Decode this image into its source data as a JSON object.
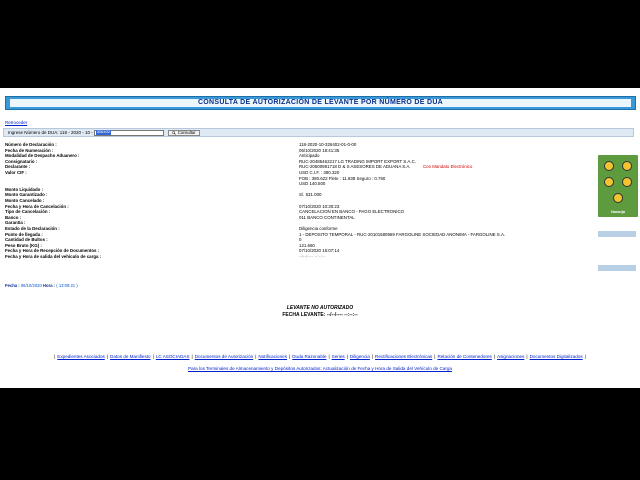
{
  "header": {
    "title": "CONSULTA DE AUTORIZACIÓN DE LEVANTE POR NÚMERO DE DUA"
  },
  "nav": {
    "back_label": "Retroceder"
  },
  "search": {
    "label": "Ingrese Número de DUA: 118 - 2020 - 10 -",
    "value": "326402",
    "button_label": "Consultar",
    "button_icon": "search-icon"
  },
  "details": [
    {
      "label": "Número de Declaración :",
      "value": "118-2020-10-326402-01-0-00"
    },
    {
      "label": "Fecha de Numeración :",
      "value": "06/10/2020 18:41:35"
    },
    {
      "label": "Modalidad de Despacho Aduanero :",
      "value": "Anticipado"
    },
    {
      "label": "Consignatario :",
      "value": "RUC-20485462217 LG TRADING IMPORT EXPORT S.A.C."
    },
    {
      "label": "Declarante :",
      "value": "RUC-20500981718 D & S ASESORES DE ADUANA S.A.",
      "value_extra": "Con Mandato Electrónico"
    },
    {
      "label": "Valor CIF :",
      "value": "USD C.I.F. : 380.320"
    },
    {
      "label": "",
      "value": "FOB : 380.622  Flete : 11.838  Seguro : 0.760"
    },
    {
      "label": "",
      "value": "USD 140.500"
    },
    {
      "label": "Monto Liquidado :",
      "value": ""
    },
    {
      "label": "Monto Garantizado :",
      "value": "S/. 531.000"
    },
    {
      "label": "Monto Cancelado :",
      "value": ""
    },
    {
      "label": "Fecha y Hora de Cancelación :",
      "value": "07/10/2020 10:30:23"
    },
    {
      "label": "Tipo de Cancelación :",
      "value": "CANCELACION EN BANCO - PAGO ELECTRONICO"
    },
    {
      "label": "Banco :",
      "value": "011 BANCO CONTINENTAL"
    },
    {
      "label": "Garantía :",
      "value": ""
    },
    {
      "label": "Estado de la Declaración :",
      "value": "Diligencia conforme"
    },
    {
      "label": "Punto de llegada :",
      "value": "1 - DEPOSITO TEMPORAL - RUC-20101580969 FARGOLINE SOCIEDAD ANONIMA - FARGOLINE S.A."
    },
    {
      "label": "Cantidad de Bultos :",
      "value": "0"
    },
    {
      "label": "Peso Bruto (KG) :",
      "value": "121.660"
    },
    {
      "label": "Fecha y Hora de Recepción de Documentos :",
      "value": "07/10/2020 16:07:14"
    },
    {
      "label": "Fecha y Hora de salida del vehículo de carga :",
      "value": "--/--/---- --:--:--"
    }
  ],
  "semaforo": {
    "label": "Naranja",
    "color": "#5e9a3e"
  },
  "timestamp": {
    "fecha_label": "Fecha :",
    "fecha_value": "06/10/2020",
    "hora_label": "Hora :",
    "hora_value": "( 13:09:21 )"
  },
  "levante": {
    "status": "LEVANTE NO AUTORIZADO",
    "fecha_label": "FECHA LEVANTE:",
    "fecha_value": "--/--/---- --:--:--"
  },
  "links": [
    "Expedientes Asociados",
    "Datos de Manifiesto",
    "LC ASOCIADAS",
    "Documentos de Autorización",
    "Notificaciones",
    "Duda Razonable",
    "Series",
    "Diligencia",
    "Rectificaciones Electrónicas",
    "Relación de Contenedores",
    "Asignaciones",
    "Documentos Digitalizados"
  ],
  "footer_link": "Para los Terminales de Almacenamiento y Depósitos Autorizados: Actualización de Fecha y Hora de Salida del Vehículo de Carga"
}
